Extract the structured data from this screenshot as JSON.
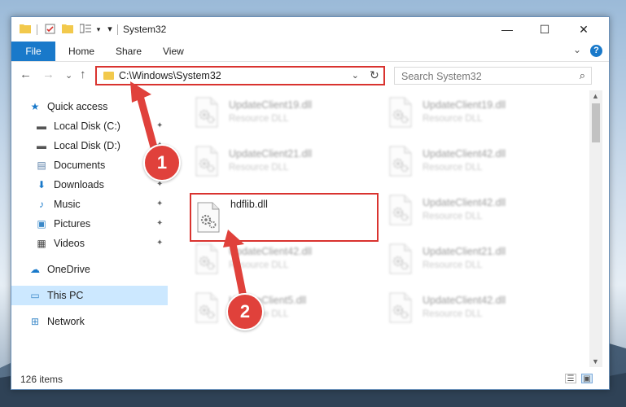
{
  "window": {
    "title": "System32",
    "minimize_glyph": "—",
    "maximize_glyph": "☐",
    "close_glyph": "✕"
  },
  "ribbon": {
    "file_label": "File",
    "tabs": [
      "Home",
      "Share",
      "View"
    ],
    "help_glyph": "?",
    "collapse_glyph": "⌄"
  },
  "navigation": {
    "back_glyph": "←",
    "forward_glyph": "→",
    "recent_glyph": "⌄",
    "up_glyph": "↑",
    "address_path": "C:\\Windows\\System32",
    "address_dropdown_glyph": "⌄",
    "refresh_glyph": "↻",
    "search_placeholder": "Search System32",
    "search_glyph": "⌕"
  },
  "sidebar": {
    "items": [
      {
        "label": "Quick access",
        "icon": "star-icon",
        "glyph": "★",
        "pinned": false
      },
      {
        "label": "Local Disk (C:)",
        "icon": "drive-icon",
        "glyph": "▬",
        "pinned": true
      },
      {
        "label": "Local Disk (D:)",
        "icon": "drive-icon",
        "glyph": "▬",
        "pinned": true
      },
      {
        "label": "Documents",
        "icon": "document-icon",
        "glyph": "▤",
        "pinned": true
      },
      {
        "label": "Downloads",
        "icon": "download-icon",
        "glyph": "⬇",
        "pinned": true
      },
      {
        "label": "Music",
        "icon": "music-icon",
        "glyph": "♪",
        "pinned": true
      },
      {
        "label": "Pictures",
        "icon": "picture-icon",
        "glyph": "▣",
        "pinned": true
      },
      {
        "label": "Videos",
        "icon": "video-icon",
        "glyph": "▦",
        "pinned": true
      },
      {
        "label": "OneDrive",
        "icon": "cloud-icon",
        "glyph": "☁",
        "pinned": false
      },
      {
        "label": "This PC",
        "icon": "computer-icon",
        "glyph": "▭",
        "pinned": false,
        "selected": true
      },
      {
        "label": "Network",
        "icon": "network-icon",
        "glyph": "⊞",
        "pinned": false
      }
    ],
    "pin_glyph": "📌"
  },
  "files": [
    {
      "name": "UpdateClient19.dll",
      "type": "Resource DLL",
      "blurred": true
    },
    {
      "name": "UpdateClient19.dll",
      "type": "Resource DLL",
      "blurred": true
    },
    {
      "name": "UpdateClient21.dll",
      "type": "Resource DLL",
      "blurred": true
    },
    {
      "name": "UpdateClient42.dll",
      "type": "Resource DLL",
      "blurred": true
    },
    {
      "name": "hdflib.dll",
      "type": "",
      "blurred": false,
      "highlighted": true
    },
    {
      "name": "UpdateClient42.dll",
      "type": "Resource DLL",
      "blurred": true
    },
    {
      "name": "UpdateClient42.dll",
      "type": "Resource DLL",
      "blurred": true
    },
    {
      "name": "UpdateClient21.dll",
      "type": "Resource DLL",
      "blurred": true
    },
    {
      "name": "UpdateClient5.dll",
      "type": "Resource DLL",
      "blurred": true
    },
    {
      "name": "UpdateClient42.dll",
      "type": "Resource DLL",
      "blurred": true
    }
  ],
  "status": {
    "item_count": "126 items"
  },
  "annotations": {
    "step1": "1",
    "step2": "2",
    "color": "#e0413b"
  }
}
